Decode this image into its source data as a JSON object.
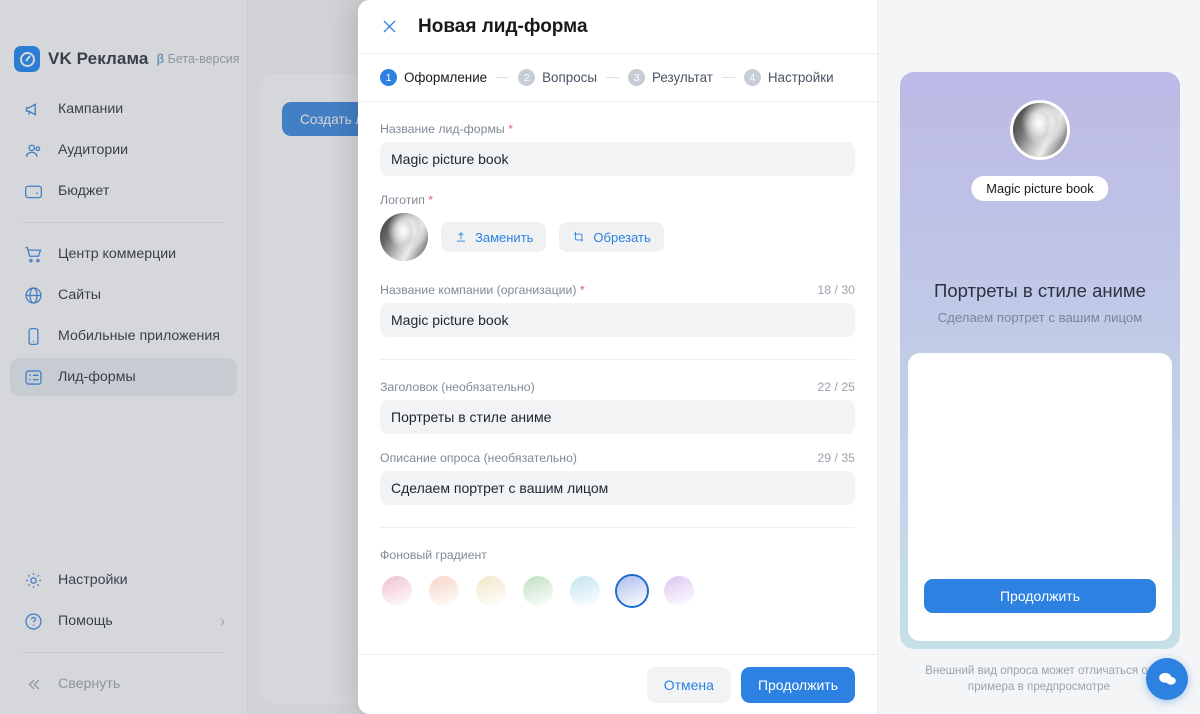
{
  "brand": {
    "name": "VK Реклама",
    "beta_b": "β",
    "beta_label": "Бета-версия"
  },
  "sidebar": {
    "items": [
      {
        "label": "Кампании",
        "icon": "megaphone-icon"
      },
      {
        "label": "Аудитории",
        "icon": "audience-icon"
      },
      {
        "label": "Бюджет",
        "icon": "wallet-icon"
      },
      {
        "label": "Центр коммерции",
        "icon": "cart-icon"
      },
      {
        "label": "Сайты",
        "icon": "globe-icon"
      },
      {
        "label": "Мобильные приложения",
        "icon": "mobile-icon"
      },
      {
        "label": "Лид-формы",
        "icon": "lead-form-icon"
      }
    ],
    "bottom": [
      {
        "label": "Настройки",
        "icon": "gear-icon"
      },
      {
        "label": "Помощь",
        "icon": "question-icon",
        "chevron": "›"
      }
    ],
    "collapse": {
      "label": "Свернуть",
      "icon": "chevrons-left-icon"
    }
  },
  "background": {
    "create_button": "Создать лид-форму"
  },
  "modal": {
    "title": "Новая лид-форма",
    "close_icon": "close-icon",
    "steps": [
      {
        "num": "1",
        "label": "Оформление",
        "active": true
      },
      {
        "num": "2",
        "label": "Вопросы",
        "active": false
      },
      {
        "num": "3",
        "label": "Результат",
        "active": false
      },
      {
        "num": "4",
        "label": "Настройки",
        "active": false
      }
    ],
    "fields": {
      "form_name": {
        "label": "Название лид-формы",
        "required": "*",
        "value": "Magic picture book"
      },
      "logo": {
        "label": "Логотип",
        "required": "*",
        "replace_button": "Заменить",
        "replace_icon": "upload-icon",
        "crop_button": "Обрезать",
        "crop_icon": "crop-icon"
      },
      "company_name": {
        "label": "Название компании (организации)",
        "required": "*",
        "counter": "18 / 30",
        "value": "Magic picture book"
      },
      "heading": {
        "label": "Заголовок (необязательно)",
        "counter": "22 / 25",
        "value": "Портреты в стиле аниме"
      },
      "description": {
        "label": "Описание опроса (необязательно)",
        "counter": "29 / 35",
        "value": "Сделаем портрет с вашим лицом"
      },
      "gradient": {
        "label": "Фоновый градиент",
        "swatches": [
          {
            "name": "pink",
            "color": "#f0c0d3",
            "selected": false
          },
          {
            "name": "peach",
            "color": "#f6d5c6",
            "selected": false
          },
          {
            "name": "cream",
            "color": "#f1e6c8",
            "selected": false
          },
          {
            "name": "green",
            "color": "#bfe0c2",
            "selected": false
          },
          {
            "name": "cyan",
            "color": "#c2e4ee",
            "selected": false
          },
          {
            "name": "blue",
            "color": "#aebcee",
            "selected": true
          },
          {
            "name": "violet",
            "color": "#dcc6f0",
            "selected": false
          }
        ],
        "selected_border": "#1c6ed0"
      }
    },
    "footer": {
      "cancel": "Отмена",
      "submit": "Продолжить"
    }
  },
  "preview": {
    "company_pill": "Magic picture book",
    "title": "Портреты в стиле аниме",
    "subtitle": "Сделаем портрет с вашим лицом",
    "cta": "Продолжить",
    "note": "Внешний вид опроса может отличаться от примера в предпросмотре",
    "gradient_top": "#bcb9e6",
    "gradient_bottom": "#c6dfe8",
    "chat_icon": "chat-bubble-icon"
  },
  "colors": {
    "accent": "#2d81e0",
    "required": "#e8607e",
    "muted": "#99a2ad"
  }
}
